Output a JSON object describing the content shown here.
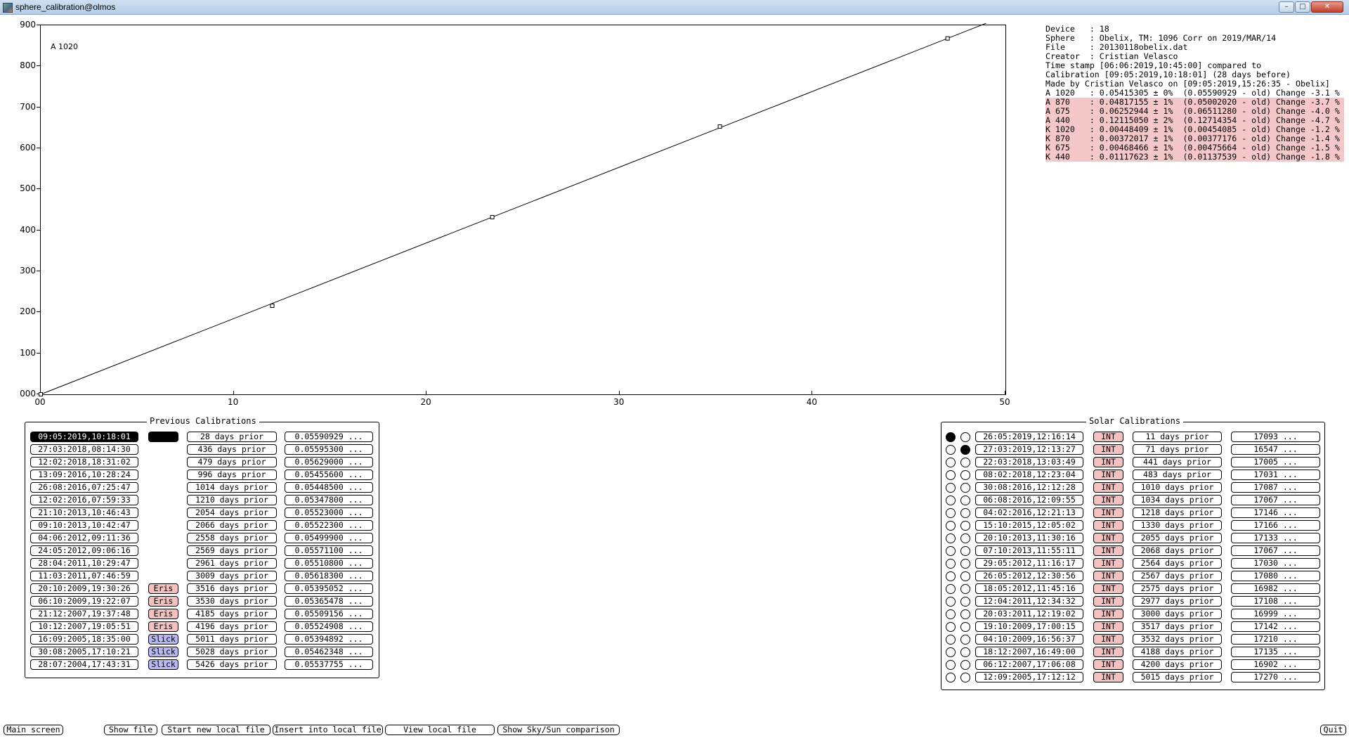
{
  "window": {
    "title": "sphere_calibration@olmos"
  },
  "plot": {
    "label": "A 1020",
    "y_ticks": [
      "900",
      "800",
      "700",
      "600",
      "500",
      "400",
      "300",
      "200",
      "100",
      "000"
    ],
    "x_ticks": [
      "00",
      "10",
      "20",
      "30",
      "40",
      "50"
    ]
  },
  "chart_data": {
    "type": "scatter",
    "title": "A 1020",
    "xlim": [
      0,
      50
    ],
    "ylim": [
      0,
      900
    ],
    "points": [
      {
        "x": 0,
        "y": 0
      },
      {
        "x": 12.0,
        "y": 216
      },
      {
        "x": 23.4,
        "y": 432
      },
      {
        "x": 35.2,
        "y": 653
      },
      {
        "x": 47.0,
        "y": 868
      }
    ],
    "fit_line": {
      "x": [
        0,
        49
      ],
      "y": [
        0,
        905
      ]
    }
  },
  "info_lines": [
    {
      "text": "Device   : 18",
      "hl": false
    },
    {
      "text": "Sphere   : Obelix, TM: 1096 Corr on 2019/MAR/14",
      "hl": false
    },
    {
      "text": "File     : 20130118obelix.dat",
      "hl": false
    },
    {
      "text": "Creator  : Cristian Velasco",
      "hl": false
    },
    {
      "text": "Time stamp [06:06:2019,10:45:00] compared to",
      "hl": false
    },
    {
      "text": "Calibration [09:05:2019,10:18:01] (28 days before)",
      "hl": false
    },
    {
      "text": "Made by Cristian Velasco on [09:05:2019,15:26:35 - Obelix]",
      "hl": false
    },
    {
      "text": "A 1020   : 0.05415305 ± 0%  (0.05590929 - old) Change -3.1 %",
      "hl": false
    },
    {
      "text": "A 870    : 0.04817155 ± 1%  (0.05002020 - old) Change -3.7 %",
      "hl": true
    },
    {
      "text": "A 675    : 0.06252944 ± 1%  (0.06511280 - old) Change -4.0 %",
      "hl": true
    },
    {
      "text": "A 440    : 0.12115050 ± 2%  (0.12714354 - old) Change -4.7 %",
      "hl": true
    },
    {
      "text": "K 1020   : 0.00448409 ± 1%  (0.00454085 - old) Change -1.2 %",
      "hl": true
    },
    {
      "text": "K 870    : 0.00372017 ± 1%  (0.00377176 - old) Change -1.4 %",
      "hl": true
    },
    {
      "text": "K 675    : 0.00468466 ± 1%  (0.00475664 - old) Change -1.5 %",
      "hl": true
    },
    {
      "text": "K 440    : 0.01117623 ± 1%  (0.01137539 - old) Change -1.8 %",
      "hl": true
    }
  ],
  "previous": {
    "title": "Previous Calibrations",
    "rows": [
      {
        "date": "09:05:2019,10:18:01",
        "tag": "",
        "tag_style": "black",
        "prior": "28 days prior",
        "value": "0.05590929 ...",
        "selected": true
      },
      {
        "date": "27:03:2018,08:14:30",
        "tag": "",
        "tag_style": "",
        "prior": "436 days prior",
        "value": "0.05595300 ...",
        "selected": false
      },
      {
        "date": "12:02:2018,18:31:02",
        "tag": "",
        "tag_style": "",
        "prior": "479 days prior",
        "value": "0.05629000 ...",
        "selected": false
      },
      {
        "date": "13:09:2016,10:28:24",
        "tag": "",
        "tag_style": "",
        "prior": "996 days prior",
        "value": "0.05455600 ...",
        "selected": false
      },
      {
        "date": "26:08:2016,07:25:47",
        "tag": "",
        "tag_style": "",
        "prior": "1014 days prior",
        "value": "0.05448500 ...",
        "selected": false
      },
      {
        "date": "12:02:2016,07:59:33",
        "tag": "",
        "tag_style": "",
        "prior": "1210 days prior",
        "value": "0.05347800 ...",
        "selected": false
      },
      {
        "date": "21:10:2013,10:46:43",
        "tag": "",
        "tag_style": "",
        "prior": "2054 days prior",
        "value": "0.05523000 ...",
        "selected": false
      },
      {
        "date": "09:10:2013,10:42:47",
        "tag": "",
        "tag_style": "",
        "prior": "2066 days prior",
        "value": "0.05522300 ...",
        "selected": false
      },
      {
        "date": "04:06:2012,09:11:36",
        "tag": "",
        "tag_style": "",
        "prior": "2558 days prior",
        "value": "0.05499900 ...",
        "selected": false
      },
      {
        "date": "24:05:2012,09:06:16",
        "tag": "",
        "tag_style": "",
        "prior": "2569 days prior",
        "value": "0.05571100 ...",
        "selected": false
      },
      {
        "date": "28:04:2011,10:29:47",
        "tag": "",
        "tag_style": "",
        "prior": "2961 days prior",
        "value": "0.05510800 ...",
        "selected": false
      },
      {
        "date": "11:03:2011,07:46:59",
        "tag": "",
        "tag_style": "",
        "prior": "3009 days prior",
        "value": "0.05618300 ...",
        "selected": false
      },
      {
        "date": "20:10:2009,19:30:26",
        "tag": "Eris",
        "tag_style": "eris",
        "prior": "3516 days prior",
        "value": "0.05395052 ...",
        "selected": false
      },
      {
        "date": "06:10:2009,19:22:07",
        "tag": "Eris",
        "tag_style": "eris",
        "prior": "3530 days prior",
        "value": "0.05365478 ...",
        "selected": false
      },
      {
        "date": "21:12:2007,19:37:48",
        "tag": "Eris",
        "tag_style": "eris",
        "prior": "4185 days prior",
        "value": "0.05509156 ...",
        "selected": false
      },
      {
        "date": "10:12:2007,19:05:51",
        "tag": "Eris",
        "tag_style": "eris",
        "prior": "4196 days prior",
        "value": "0.05524908 ...",
        "selected": false
      },
      {
        "date": "16:09:2005,18:35:00",
        "tag": "Slick",
        "tag_style": "slick",
        "prior": "5011 days prior",
        "value": "0.05394892 ...",
        "selected": false
      },
      {
        "date": "30:08:2005,17:10:21",
        "tag": "Slick",
        "tag_style": "slick",
        "prior": "5028 days prior",
        "value": "0.05462348 ...",
        "selected": false
      },
      {
        "date": "28:07:2004,17:43:31",
        "tag": "Slick",
        "tag_style": "slick",
        "prior": "5426 days prior",
        "value": "0.05537755 ...",
        "selected": false
      }
    ]
  },
  "solar": {
    "title": "Solar Calibrations",
    "rows": [
      {
        "r1": true,
        "r2": false,
        "date": "26:05:2019,12:16:14",
        "type": "INT",
        "prior": "11 days prior",
        "value": "17093 ..."
      },
      {
        "r1": false,
        "r2": true,
        "date": "27:03:2019,12:13:27",
        "type": "INT",
        "prior": "71 days prior",
        "value": "16547 ..."
      },
      {
        "r1": false,
        "r2": false,
        "date": "22:03:2018,13:03:49",
        "type": "INT",
        "prior": "441 days prior",
        "value": "17005 ..."
      },
      {
        "r1": false,
        "r2": false,
        "date": "08:02:2018,12:23:04",
        "type": "INT",
        "prior": "483 days prior",
        "value": "17031 ..."
      },
      {
        "r1": false,
        "r2": false,
        "date": "30:08:2016,12:12:28",
        "type": "INT",
        "prior": "1010 days prior",
        "value": "17087 ..."
      },
      {
        "r1": false,
        "r2": false,
        "date": "06:08:2016,12:09:55",
        "type": "INT",
        "prior": "1034 days prior",
        "value": "17067 ..."
      },
      {
        "r1": false,
        "r2": false,
        "date": "04:02:2016,12:21:13",
        "type": "INT",
        "prior": "1218 days prior",
        "value": "17146 ..."
      },
      {
        "r1": false,
        "r2": false,
        "date": "15:10:2015,12:05:02",
        "type": "INT",
        "prior": "1330 days prior",
        "value": "17166 ..."
      },
      {
        "r1": false,
        "r2": false,
        "date": "20:10:2013,11:30:16",
        "type": "INT",
        "prior": "2055 days prior",
        "value": "17133 ..."
      },
      {
        "r1": false,
        "r2": false,
        "date": "07:10:2013,11:55:11",
        "type": "INT",
        "prior": "2068 days prior",
        "value": "17067 ..."
      },
      {
        "r1": false,
        "r2": false,
        "date": "29:05:2012,11:16:17",
        "type": "INT",
        "prior": "2564 days prior",
        "value": "17030 ..."
      },
      {
        "r1": false,
        "r2": false,
        "date": "26:05:2012,12:30:56",
        "type": "INT",
        "prior": "2567 days prior",
        "value": "17080 ..."
      },
      {
        "r1": false,
        "r2": false,
        "date": "18:05:2012,11:45:16",
        "type": "INT",
        "prior": "2575 days prior",
        "value": "16982 ..."
      },
      {
        "r1": false,
        "r2": false,
        "date": "12:04:2011,12:34:32",
        "type": "INT",
        "prior": "2977 days prior",
        "value": "17108 ..."
      },
      {
        "r1": false,
        "r2": false,
        "date": "20:03:2011,12:19:02",
        "type": "INT",
        "prior": "3000 days prior",
        "value": "16999 ..."
      },
      {
        "r1": false,
        "r2": false,
        "date": "19:10:2009,17:00:15",
        "type": "INT",
        "prior": "3517 days prior",
        "value": "17142 ..."
      },
      {
        "r1": false,
        "r2": false,
        "date": "04:10:2009,16:56:37",
        "type": "INT",
        "prior": "3532 days prior",
        "value": "17210 ..."
      },
      {
        "r1": false,
        "r2": false,
        "date": "18:12:2007,16:49:00",
        "type": "INT",
        "prior": "4188 days prior",
        "value": "17135 ..."
      },
      {
        "r1": false,
        "r2": false,
        "date": "06:12:2007,17:06:08",
        "type": "INT",
        "prior": "4200 days prior",
        "value": "16902 ..."
      },
      {
        "r1": false,
        "r2": false,
        "date": "12:09:2005,17:12:12",
        "type": "INT",
        "prior": "5015 days prior",
        "value": "17270 ..."
      }
    ]
  },
  "bottom": {
    "main": "Main screen",
    "show_file": "Show file",
    "start_new": "Start new local file",
    "insert": "Insert into local file",
    "view_local": "View local file",
    "show_sky": "Show Sky/Sun comparison",
    "quit": "Quit"
  },
  "colors": {
    "highlight": "#f4c8c8",
    "eris": "#f4c0c0",
    "slick": "#b8b8f4",
    "int": "#f4c0c0"
  }
}
